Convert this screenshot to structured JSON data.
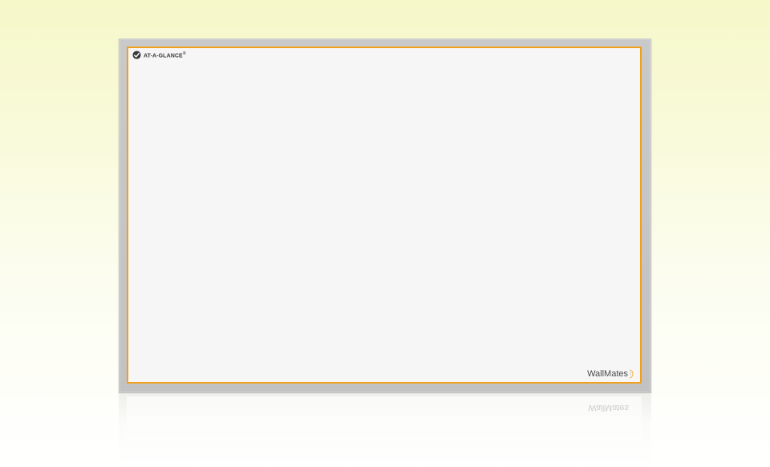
{
  "board": {
    "brand_name": "AT-A-GLANCE",
    "brand_mark": "®",
    "brand_icon": "at-a-glance-logo-icon",
    "product_name": "WallMates",
    "product_icon": "hand-mark-icon",
    "colors": {
      "frame": "#c6c6c6",
      "surface": "#f6f6f6",
      "accent_border": "#f0a01c",
      "background_top": "#f6f8c9",
      "background_bottom": "#ffffff"
    }
  }
}
